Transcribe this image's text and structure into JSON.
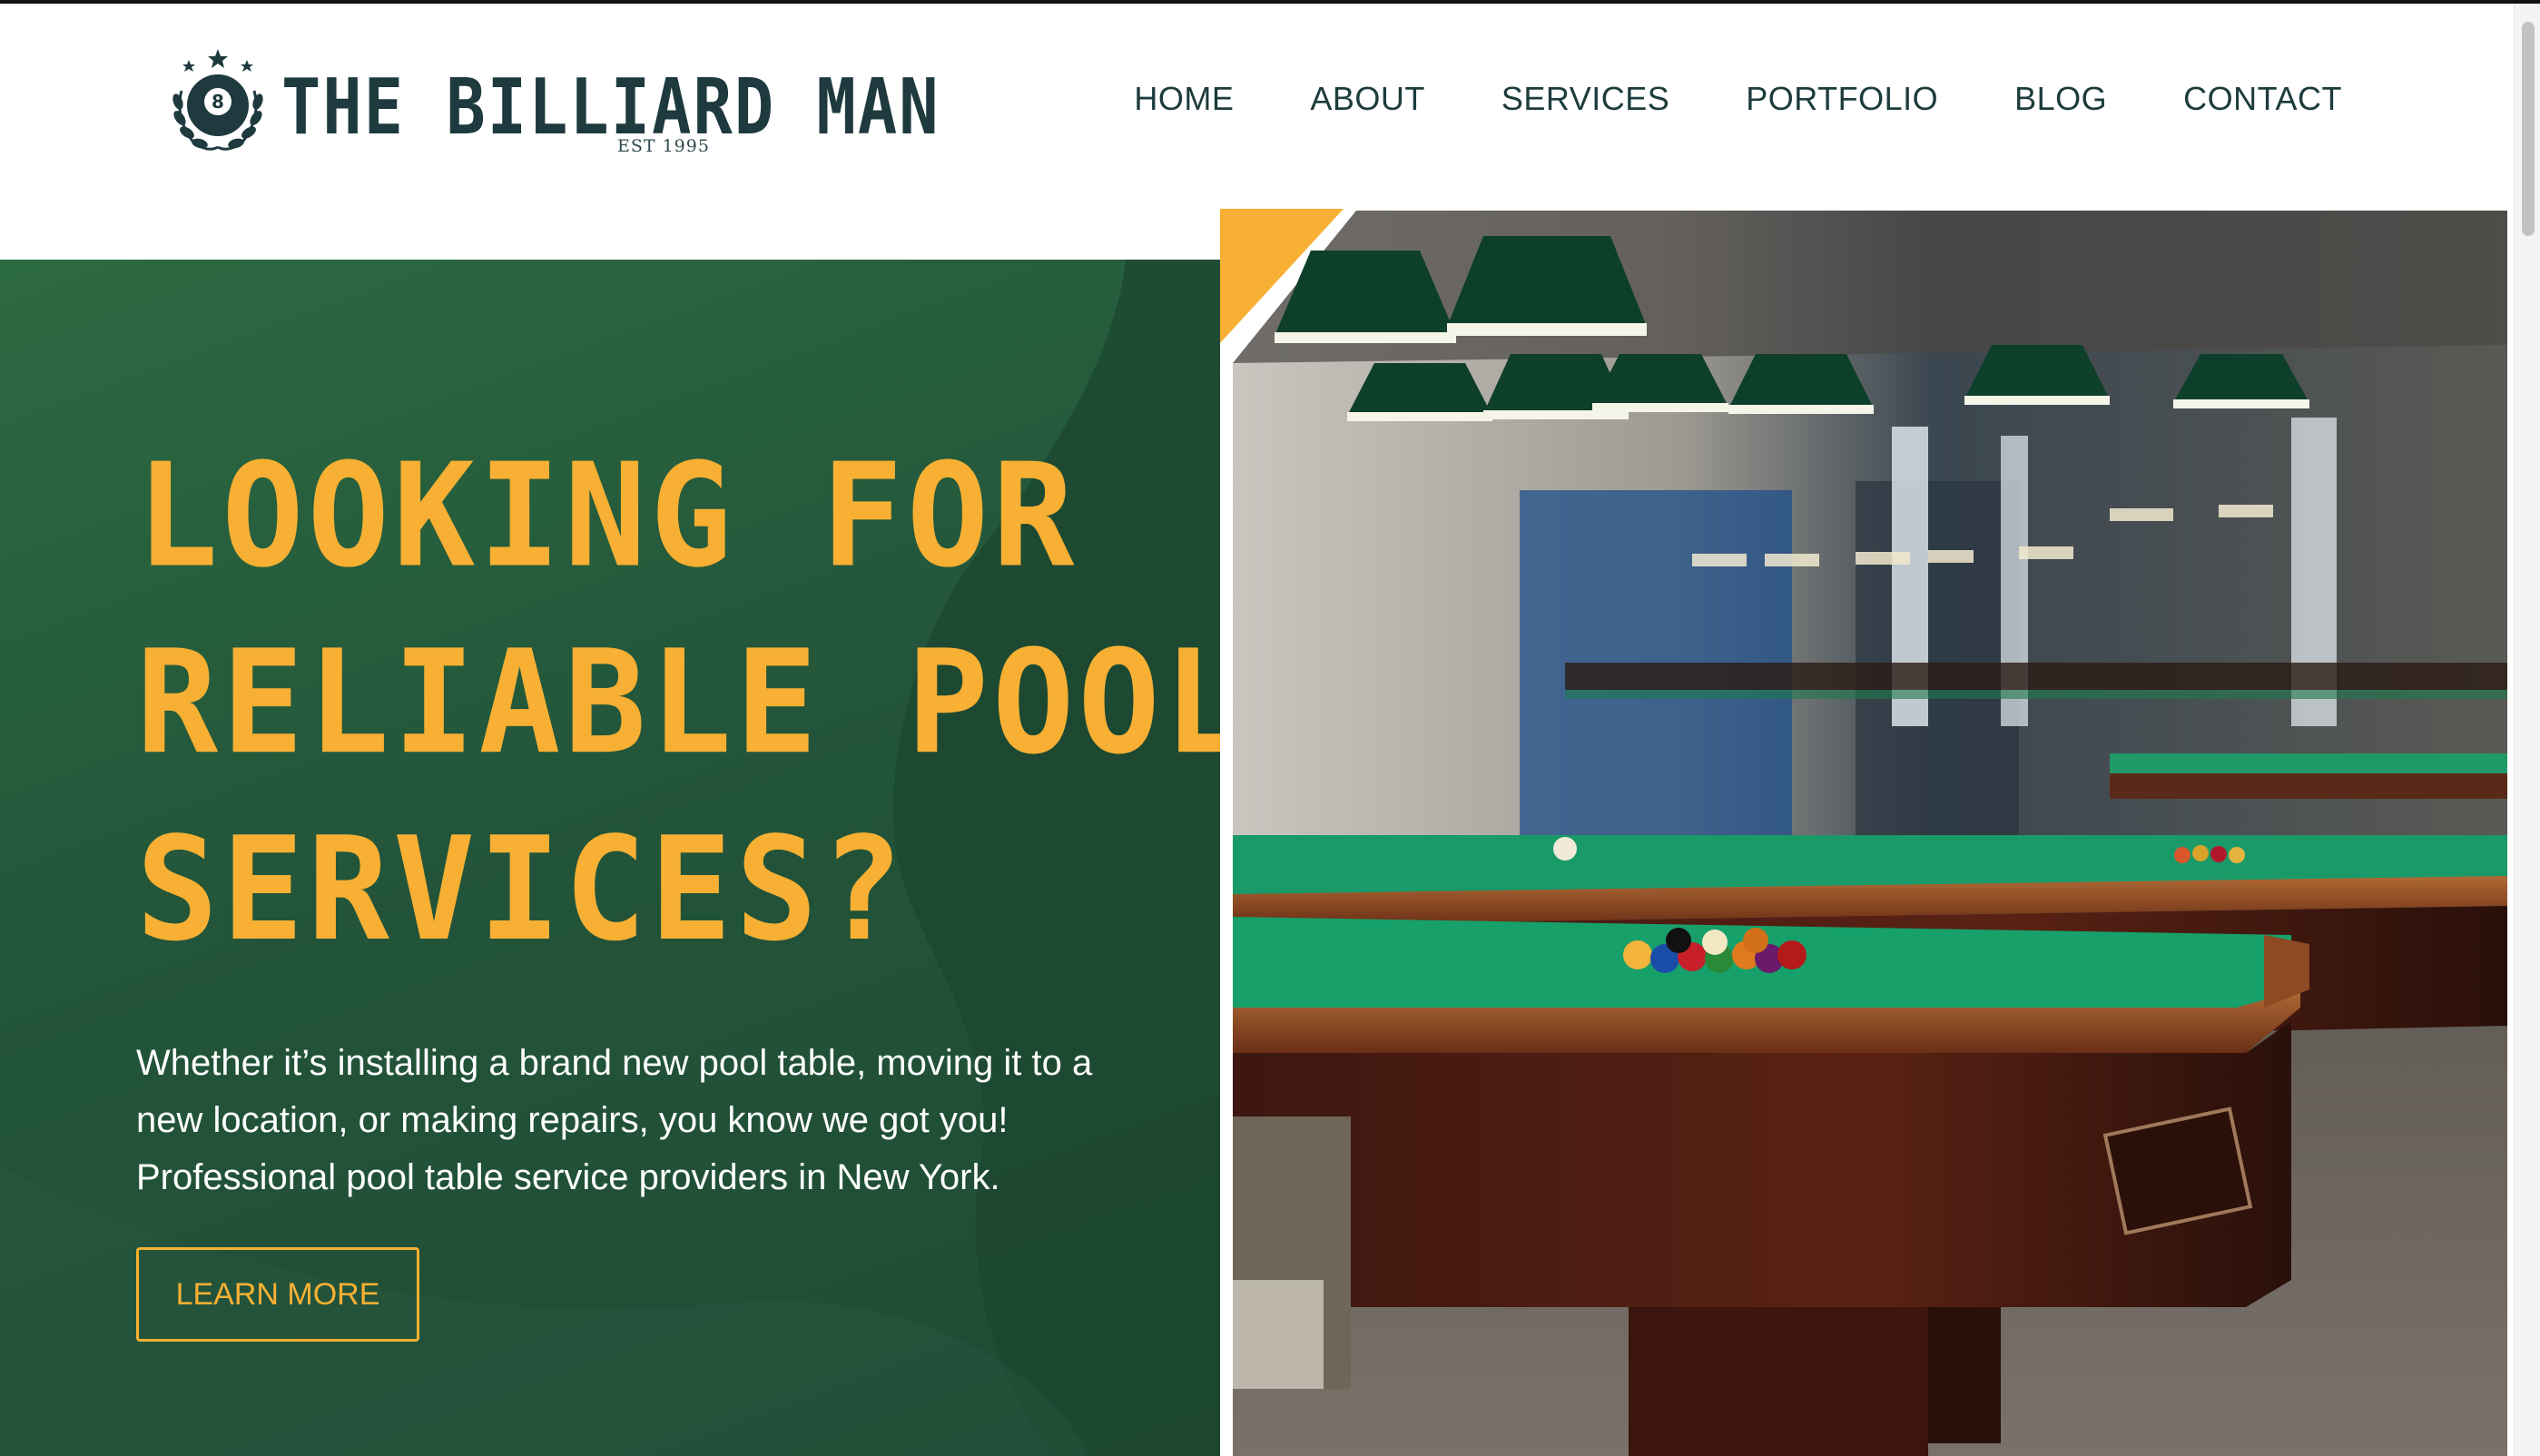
{
  "brand": {
    "name": "THE BILLIARD MAN",
    "est": "EST 1995",
    "badge_number": "8"
  },
  "nav": {
    "items": [
      {
        "label": "HOME"
      },
      {
        "label": "ABOUT"
      },
      {
        "label": "SERVICES"
      },
      {
        "label": "PORTFOLIO"
      },
      {
        "label": "BLOG"
      },
      {
        "label": "CONTACT"
      }
    ]
  },
  "hero": {
    "headline_lines": [
      "LOOKING FOR",
      "RELIABLE POOL TABLE",
      "SERVICES?"
    ],
    "subtext": "Whether it’s installing a brand new pool table, moving it to a new location, or making repairs, you know we got you! Professional pool table service providers in New York.",
    "cta_label": "LEARN MORE"
  },
  "colors": {
    "accent": "#f7b033",
    "hero_green": "#23553a",
    "nav_text": "#1d3c3c",
    "felt_green": "#17a06a"
  },
  "icons": {
    "logo_badge": "eight-ball-laurel-icon"
  }
}
